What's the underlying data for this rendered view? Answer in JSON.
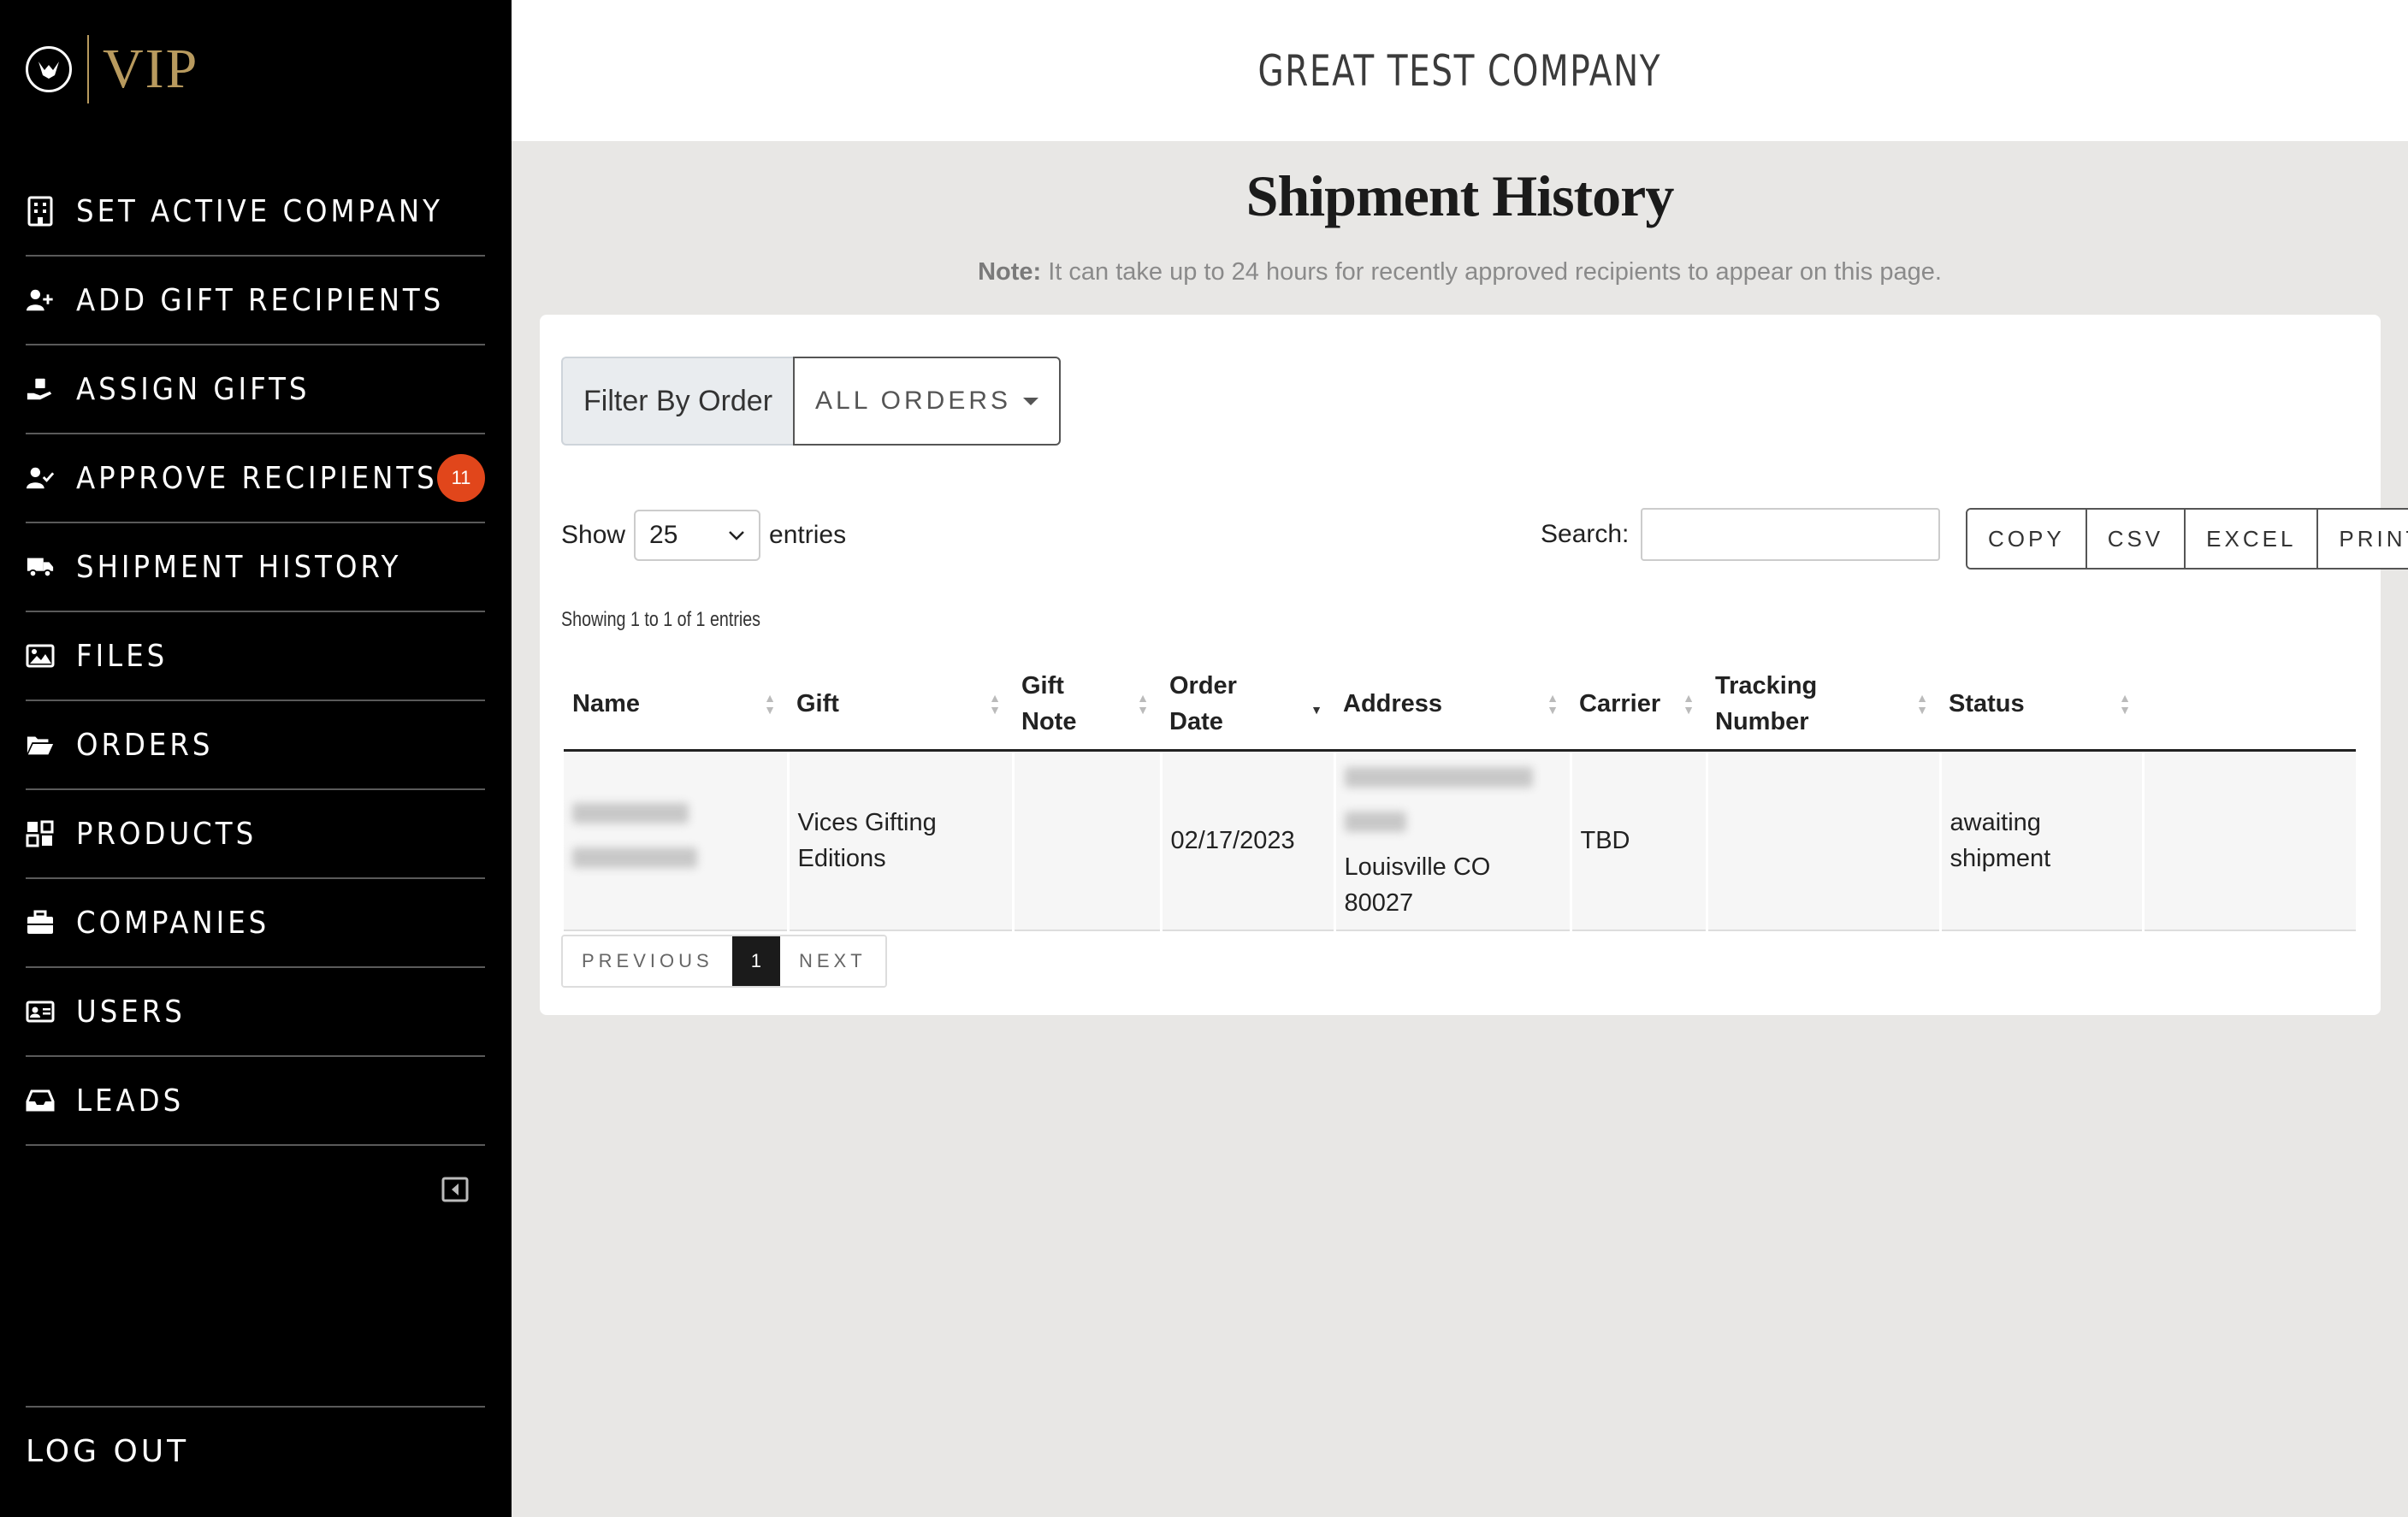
{
  "brand": {
    "logo_text": "VIP"
  },
  "sidebar": {
    "items": [
      {
        "label": "SET ACTIVE COMPANY",
        "icon": "building-icon"
      },
      {
        "label": "ADD GIFT RECIPIENTS",
        "icon": "user-plus-icon"
      },
      {
        "label": "ASSIGN GIFTS",
        "icon": "hand-gift-icon"
      },
      {
        "label": "APPROVE RECIPIENTS",
        "icon": "user-check-icon",
        "badge": "11"
      },
      {
        "label": "SHIPMENT HISTORY",
        "icon": "truck-icon"
      },
      {
        "label": "FILES",
        "icon": "image-icon"
      },
      {
        "label": "ORDERS",
        "icon": "folder-open-icon"
      },
      {
        "label": "PRODUCTS",
        "icon": "boxes-icon"
      },
      {
        "label": "COMPANIES",
        "icon": "briefcase-icon"
      },
      {
        "label": "USERS",
        "icon": "id-card-icon"
      },
      {
        "label": "LEADS",
        "icon": "inbox-icon"
      }
    ],
    "logout_label": "LOG OUT",
    "badge_color": "#e1461b"
  },
  "header": {
    "company_name": "GREAT TEST COMPANY"
  },
  "page": {
    "title": "Shipment History",
    "note_label": "Note:",
    "note_text": " It can take up to 24 hours for recently approved recipients to appear on this page."
  },
  "filter": {
    "label": "Filter By Order",
    "selected": "ALL ORDERS"
  },
  "controls": {
    "show_label": "Show",
    "entries_value": "25",
    "entries_label": "entries",
    "search_label": "Search:",
    "search_value": "",
    "export_buttons": [
      "COPY",
      "CSV",
      "EXCEL",
      "PRINT"
    ],
    "showing_info": "Showing 1 to 1 of 1 entries"
  },
  "table": {
    "columns": [
      {
        "line1": "Name",
        "line2": ""
      },
      {
        "line1": "Gift",
        "line2": ""
      },
      {
        "line1": "Gift",
        "line2": "Note"
      },
      {
        "line1": "Order",
        "line2": "Date"
      },
      {
        "line1": "Address",
        "line2": ""
      },
      {
        "line1": "Carrier",
        "line2": ""
      },
      {
        "line1": "Tracking",
        "line2": "Number"
      },
      {
        "line1": "Status",
        "line2": ""
      },
      {
        "line1": "",
        "line2": ""
      }
    ],
    "rows": [
      {
        "gift_line1": "Vices Gifting",
        "gift_line2": "Editions",
        "gift_note": "",
        "order_date": "02/17/2023",
        "address_line": "Louisville CO",
        "address_zip": "80027",
        "carrier": "TBD",
        "tracking_number": "",
        "status_line1": "awaiting",
        "status_line2": "shipment"
      }
    ]
  },
  "pagination": {
    "previous": "PREVIOUS",
    "current": "1",
    "next": "NEXT"
  }
}
